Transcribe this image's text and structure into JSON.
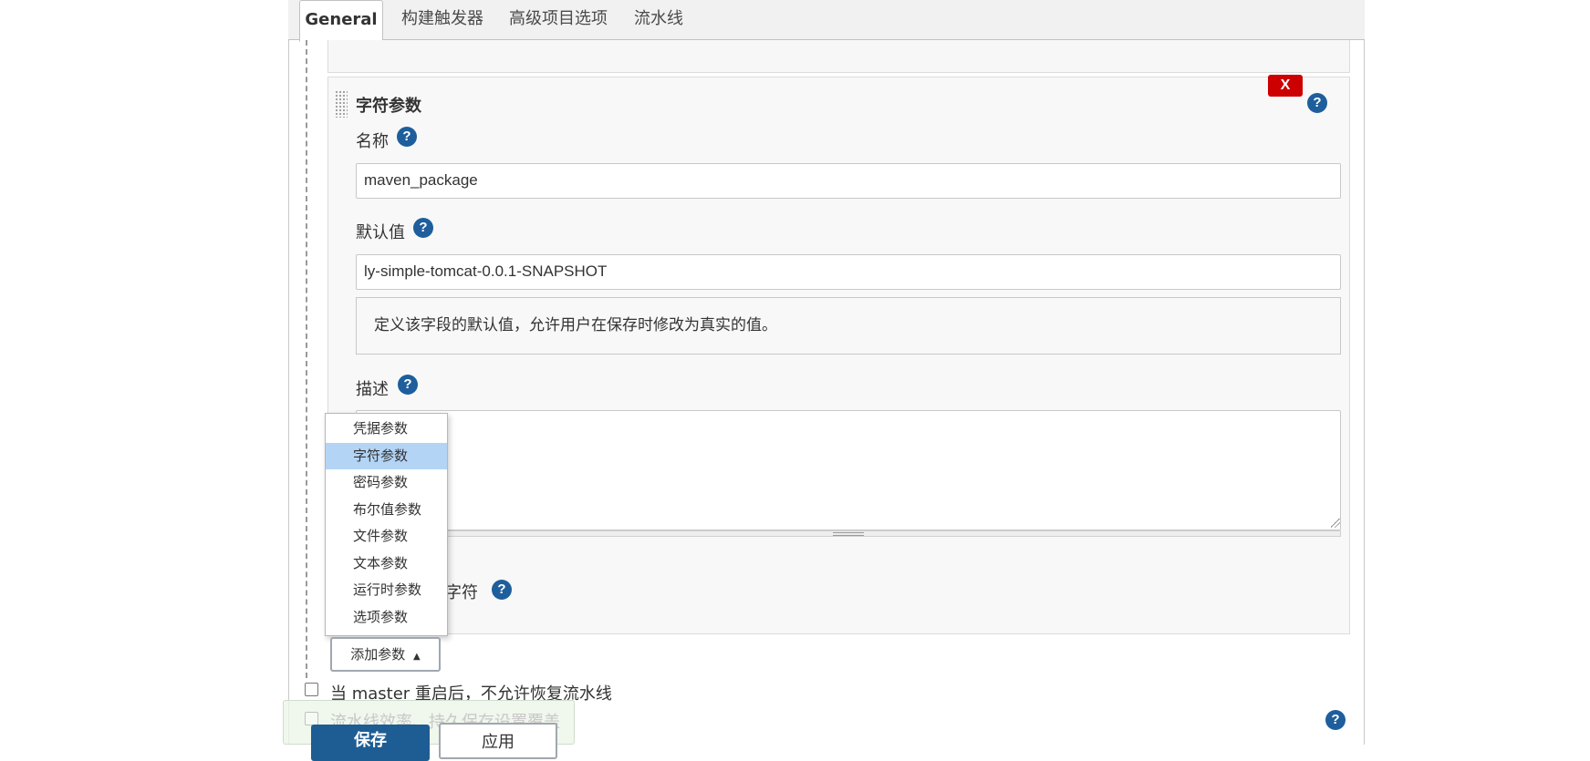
{
  "tabs": [
    {
      "label": "General",
      "active": true
    },
    {
      "label": "构建触发器"
    },
    {
      "label": "高级项目选项"
    },
    {
      "label": "流水线"
    }
  ],
  "param_block": {
    "title": "字符参数",
    "delete_label": "X",
    "help_glyph": "?",
    "name_label": "名称",
    "name_value": "maven_package",
    "default_label": "默认值",
    "default_value": "ly-simple-tomcat-0.0.1-SNAPSHOT",
    "default_help_text": "定义该字段的默认值，允许用户在保存时修改为真实的值。",
    "description_label": "描述",
    "description_value": "",
    "trim_label_partial": "字符"
  },
  "add_param_menu": {
    "items": [
      "凭据参数",
      "字符参数",
      "密码参数",
      "布尔值参数",
      "文件参数",
      "文本参数",
      "运行时参数",
      "选项参数"
    ],
    "selected": "字符参数"
  },
  "add_param_button": {
    "label": "添加参数",
    "arrow": "▲"
  },
  "checkbox_resume": {
    "label": "当 master 重启后，不允许恢复流水线",
    "checked": false
  },
  "checkbox_efficiency": {
    "label": "流水线效率、持久保存设置覆盖",
    "checked": false
  },
  "footer": {
    "save_label": "保存",
    "apply_label": "应用"
  },
  "colors": {
    "accent": "#1e5e9c",
    "danger": "#cc0000",
    "selected": "#b3d4f5"
  }
}
